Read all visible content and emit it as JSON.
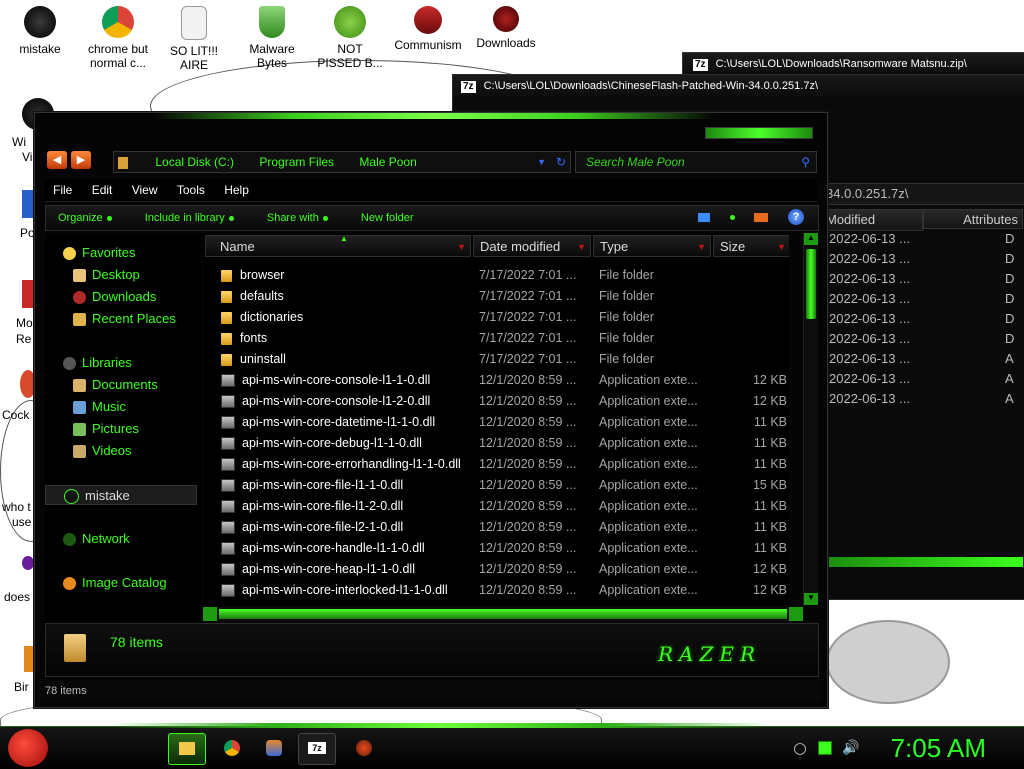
{
  "desktop": {
    "icons": [
      {
        "label": "mistake"
      },
      {
        "label": "chrome but normal c..."
      },
      {
        "label": "SO LIT!!! AIRE"
      },
      {
        "label": "Malware Bytes"
      },
      {
        "label": "NOT PISSED B..."
      },
      {
        "label": "Communism"
      },
      {
        "label": "Downloads"
      }
    ],
    "left_fragments": [
      "Wi",
      "Vi",
      "Po",
      "Mo",
      "Re",
      "Cock",
      "who t",
      "use",
      "does",
      "Bir"
    ]
  },
  "back_window_7z": {
    "title_back": "C:\\Users\\LOL\\Downloads\\Ransomware Matsnu.zip\\",
    "badge": "7z",
    "title": "C:\\Users\\LOL\\Downloads\\ChineseFlash-Patched-Win-34.0.0.251.7z\\",
    "path_fragment": "34.0.0.251.7z\\",
    "columns": [
      "Modified",
      "Attributes"
    ],
    "rows": [
      {
        "modified": "2022-06-13 ...",
        "attr": "D"
      },
      {
        "modified": "2022-06-13 ...",
        "attr": "D"
      },
      {
        "modified": "2022-06-13 ...",
        "attr": "D"
      },
      {
        "modified": "2022-06-13 ...",
        "attr": "D"
      },
      {
        "modified": "2022-06-13 ...",
        "attr": "D"
      },
      {
        "modified": "2022-06-13 ...",
        "attr": "D"
      },
      {
        "modified": "2022-06-13 ...",
        "attr": "A"
      },
      {
        "modified": "2022-06-13 ...",
        "attr": "A"
      },
      {
        "modified": "2022-06-13 ...",
        "attr": "A"
      }
    ]
  },
  "explorer": {
    "breadcrumb": [
      "Local Disk (C:)",
      "Program Files",
      "Male Poon"
    ],
    "search_placeholder": "Search Male Poon",
    "menu": [
      "File",
      "Edit",
      "View",
      "Tools",
      "Help"
    ],
    "commands": [
      "Organize",
      "Include in library",
      "Share with",
      "New folder"
    ],
    "columns": [
      "Name",
      "Date modified",
      "Type",
      "Size"
    ],
    "nav": {
      "favorites": "Favorites",
      "desktop": "Desktop",
      "downloads": "Downloads",
      "recent": "Recent Places",
      "libraries": "Libraries",
      "documents": "Documents",
      "music": "Music",
      "pictures": "Pictures",
      "videos": "Videos",
      "user": "mistake",
      "network": "Network",
      "image_catalog": "Image Catalog"
    },
    "files": [
      {
        "name": "browser",
        "date": "7/17/2022 7:01 ...",
        "type": "File folder",
        "size": "",
        "kind": "folder"
      },
      {
        "name": "defaults",
        "date": "7/17/2022 7:01 ...",
        "type": "File folder",
        "size": "",
        "kind": "folder"
      },
      {
        "name": "dictionaries",
        "date": "7/17/2022 7:01 ...",
        "type": "File folder",
        "size": "",
        "kind": "folder"
      },
      {
        "name": "fonts",
        "date": "7/17/2022 7:01 ...",
        "type": "File folder",
        "size": "",
        "kind": "folder"
      },
      {
        "name": "uninstall",
        "date": "7/17/2022 7:01 ...",
        "type": "File folder",
        "size": "",
        "kind": "folder"
      },
      {
        "name": "api-ms-win-core-console-l1-1-0.dll",
        "date": "12/1/2020 8:59 ...",
        "type": "Application exte...",
        "size": "12 KB",
        "kind": "dll"
      },
      {
        "name": "api-ms-win-core-console-l1-2-0.dll",
        "date": "12/1/2020 8:59 ...",
        "type": "Application exte...",
        "size": "12 KB",
        "kind": "dll"
      },
      {
        "name": "api-ms-win-core-datetime-l1-1-0.dll",
        "date": "12/1/2020 8:59 ...",
        "type": "Application exte...",
        "size": "11 KB",
        "kind": "dll"
      },
      {
        "name": "api-ms-win-core-debug-l1-1-0.dll",
        "date": "12/1/2020 8:59 ...",
        "type": "Application exte...",
        "size": "11 KB",
        "kind": "dll"
      },
      {
        "name": "api-ms-win-core-errorhandling-l1-1-0.dll",
        "date": "12/1/2020 8:59 ...",
        "type": "Application exte...",
        "size": "11 KB",
        "kind": "dll"
      },
      {
        "name": "api-ms-win-core-file-l1-1-0.dll",
        "date": "12/1/2020 8:59 ...",
        "type": "Application exte...",
        "size": "15 KB",
        "kind": "dll"
      },
      {
        "name": "api-ms-win-core-file-l1-2-0.dll",
        "date": "12/1/2020 8:59 ...",
        "type": "Application exte...",
        "size": "11 KB",
        "kind": "dll"
      },
      {
        "name": "api-ms-win-core-file-l2-1-0.dll",
        "date": "12/1/2020 8:59 ...",
        "type": "Application exte...",
        "size": "11 KB",
        "kind": "dll"
      },
      {
        "name": "api-ms-win-core-handle-l1-1-0.dll",
        "date": "12/1/2020 8:59 ...",
        "type": "Application exte...",
        "size": "11 KB",
        "kind": "dll"
      },
      {
        "name": "api-ms-win-core-heap-l1-1-0.dll",
        "date": "12/1/2020 8:59 ...",
        "type": "Application exte...",
        "size": "12 KB",
        "kind": "dll"
      },
      {
        "name": "api-ms-win-core-interlocked-l1-1-0.dll",
        "date": "12/1/2020 8:59 ...",
        "type": "Application exte...",
        "size": "12 KB",
        "kind": "dll"
      }
    ],
    "details_count": "78 items",
    "status_count": "78 items",
    "brand_logo": "RAZER"
  },
  "taskbar": {
    "clock": "7:05 AM",
    "seven_zip_label": "7z"
  },
  "colors": {
    "accent": "#3cff1e",
    "clock": "#2aff25",
    "dark": "#050505"
  }
}
